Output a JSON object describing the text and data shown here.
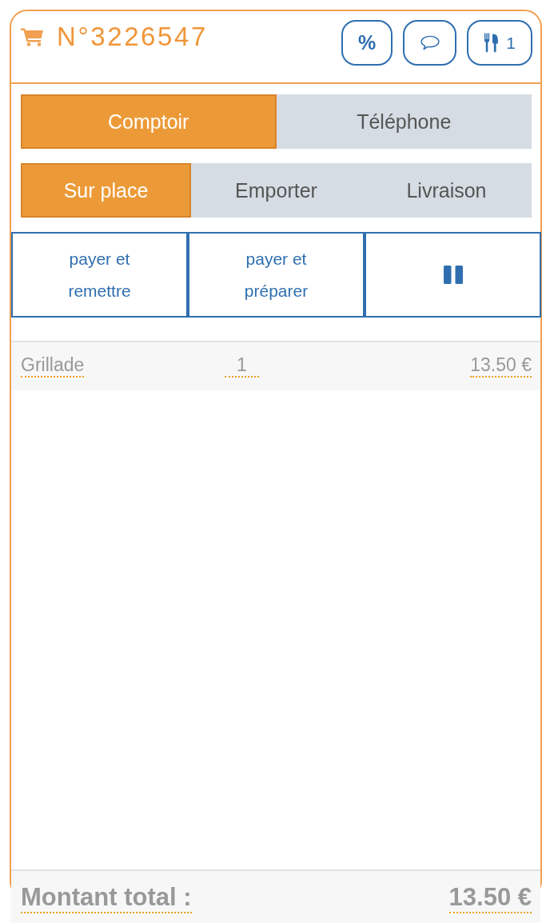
{
  "order": {
    "number": "N°3226547"
  },
  "header_buttons": [
    {
      "kind": "discount",
      "label": "%"
    },
    {
      "kind": "comment"
    },
    {
      "kind": "covers",
      "label": "1"
    }
  ],
  "channel_tabs": [
    {
      "label": "Comptoir",
      "selected": true
    },
    {
      "label": "Téléphone",
      "selected": false
    }
  ],
  "service_tabs": [
    {
      "label": "Sur place",
      "selected": true
    },
    {
      "label": "Emporter",
      "selected": false
    },
    {
      "label": "Livraison",
      "selected": false
    }
  ],
  "actions": [
    {
      "kind": "text",
      "label": "payer et remettre"
    },
    {
      "kind": "text",
      "label": "payer et préparer"
    },
    {
      "kind": "pause"
    }
  ],
  "items": [
    {
      "name": "Grillade",
      "quantity": "1",
      "price": "13.50 €"
    }
  ],
  "total": {
    "label": "Montant total :",
    "amount": "13.50 €"
  }
}
